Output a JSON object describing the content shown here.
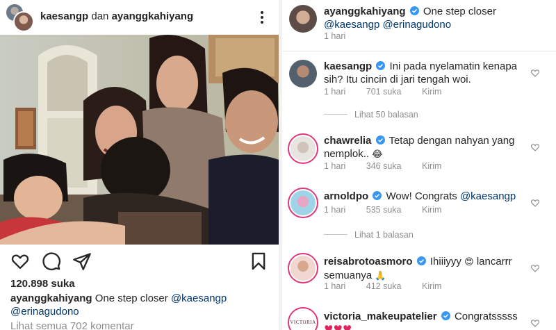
{
  "post": {
    "header": {
      "user1": "kaesangp",
      "conjunction": "dan",
      "user2": "ayanggkahiyang"
    },
    "likes": "120.898 suka",
    "caption": {
      "user": "ayanggkahiyang",
      "text": "One step closer",
      "mention1": "@kaesangp",
      "mention2": "@erinagudono"
    },
    "view_all_comments": "Lihat semua 702 komentar"
  },
  "icons": {
    "more": "more-options-icon",
    "like": "heart-icon",
    "comment": "comment-icon",
    "share": "share-icon",
    "save": "bookmark-icon",
    "verified": "verified-badge-icon"
  },
  "caption_comment": {
    "user": "ayanggkahiyang",
    "text": "One step closer",
    "mention1": "@kaesangp",
    "mention2": "@erinagudono",
    "time": "1 hari"
  },
  "comments": [
    {
      "user": "kaesangp",
      "text": "Ini pada nyelamatin kenapa sih? Itu cincin di jari tengah woi.",
      "time": "1 hari",
      "likes": "701 suka",
      "reply": "Kirim",
      "replies": "Lihat 50 balasan"
    },
    {
      "user": "chawrelia",
      "text": "Tetap dengan nahyan yang nemplok..",
      "emoji": "😂",
      "time": "1 hari",
      "likes": "346 suka",
      "reply": "Kirim"
    },
    {
      "user": "arnoldpo",
      "text": "Wow! Congrats",
      "mention": "@kaesangp",
      "time": "1 hari",
      "likes": "535 suka",
      "reply": "Kirim",
      "replies": "Lihat 1 balasan"
    },
    {
      "user": "reisabrotoasmoro",
      "text": "Ihiiiyyy",
      "emoji": "😍",
      "text2": "lancarrr semuanya",
      "emoji2": "🙏",
      "time": "1 hari",
      "likes": "412 suka",
      "reply": "Kirim"
    },
    {
      "user": "victoria_makeupatelier",
      "text": "Congratsssss",
      "hearts": "♥♥♥",
      "avatar_text": "VICTORIA"
    }
  ],
  "colors": {
    "link": "#00376b",
    "muted": "#8e8e8e",
    "verified": "#3897f0",
    "story_ring": "#e0367a"
  }
}
